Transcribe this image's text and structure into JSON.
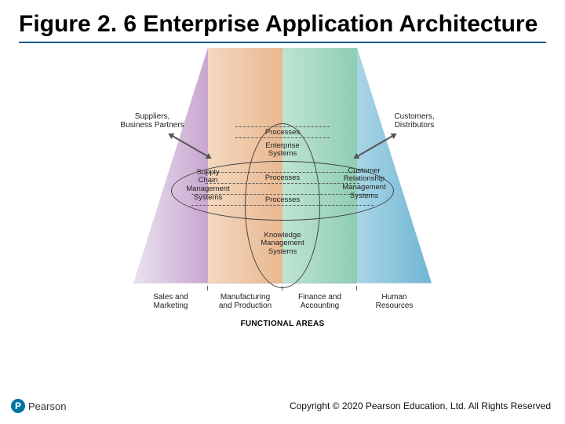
{
  "title": "Figure 2. 6 Enterprise Application Architecture",
  "actors": {
    "suppliers": "Suppliers,\nBusiness Partners",
    "customers": "Customers,\nDistributors"
  },
  "processes": [
    "Processes",
    "Processes",
    "Processes"
  ],
  "labels": {
    "enterprise_systems": "Enterprise\nSystems",
    "scm": "Supply\nChain\nManagement\nSystems",
    "crm": "Customer\nRelationship\nManagement\nSystems",
    "kms": "Knowledge\nManagement\nSystems"
  },
  "functional_areas": {
    "heading": "FUNCTIONAL AREAS",
    "items": [
      "Sales and\nMarketing",
      "Manufacturing\nand Production",
      "Finance and\nAccounting",
      "Human\nResources"
    ]
  },
  "footer": {
    "brand": "Pearson",
    "brand_letter": "P",
    "copyright": "Copyright © 2020 Pearson Education, Ltd. All Rights Reserved"
  }
}
